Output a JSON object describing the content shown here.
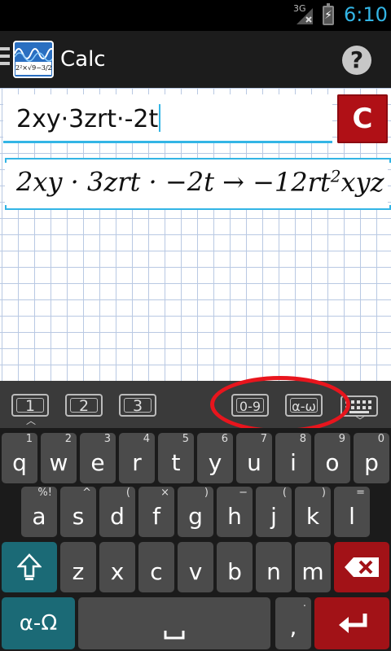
{
  "status_bar": {
    "network": "3G",
    "time": "6:10"
  },
  "action_bar": {
    "title": "Calc",
    "logo_formula": "2²×√9−3/2",
    "help_label": "?"
  },
  "input": {
    "expression": "2xy·3zrt·-2t",
    "clear_label": "C"
  },
  "result": {
    "text": "2xy · 3zrt · −2t → −12rt²xyz",
    "left": "2xy · 3zrt · −2t",
    "arrow": "→",
    "rhs_prefix": "−12rt",
    "rhs_exp": "2",
    "rhs_suffix": "xyz"
  },
  "mode_strip": {
    "keys": [
      "1",
      "2",
      "3",
      "0-9",
      "α-ω"
    ]
  },
  "keyboard": {
    "row1": [
      {
        "key": "q",
        "alt": "1"
      },
      {
        "key": "w",
        "alt": "2"
      },
      {
        "key": "e",
        "alt": "3"
      },
      {
        "key": "r",
        "alt": "4"
      },
      {
        "key": "t",
        "alt": "5"
      },
      {
        "key": "y",
        "alt": "6"
      },
      {
        "key": "u",
        "alt": "7"
      },
      {
        "key": "i",
        "alt": "8"
      },
      {
        "key": "o",
        "alt": "9"
      },
      {
        "key": "p",
        "alt": "0"
      }
    ],
    "row2": [
      {
        "key": "a",
        "alt": "%!"
      },
      {
        "key": "s",
        "alt": "^"
      },
      {
        "key": "d",
        "alt": "("
      },
      {
        "key": "f",
        "alt": "×"
      },
      {
        "key": "g",
        "alt": ")"
      },
      {
        "key": "h",
        "alt": "−"
      },
      {
        "key": "j",
        "alt": "("
      },
      {
        "key": "k",
        "alt": ")"
      },
      {
        "key": "l",
        "alt": "="
      }
    ],
    "row3": [
      "z",
      "x",
      "c",
      "v",
      "b",
      "n",
      "m"
    ],
    "row4": {
      "greek": "α-Ω",
      "comma": ",",
      "comma_alt": "."
    },
    "colors": {
      "shift": "#1b6a76",
      "delete": "#a21217",
      "enter": "#a21217",
      "key": "#4b4b4b"
    }
  },
  "highlight_color": "#e8151d"
}
